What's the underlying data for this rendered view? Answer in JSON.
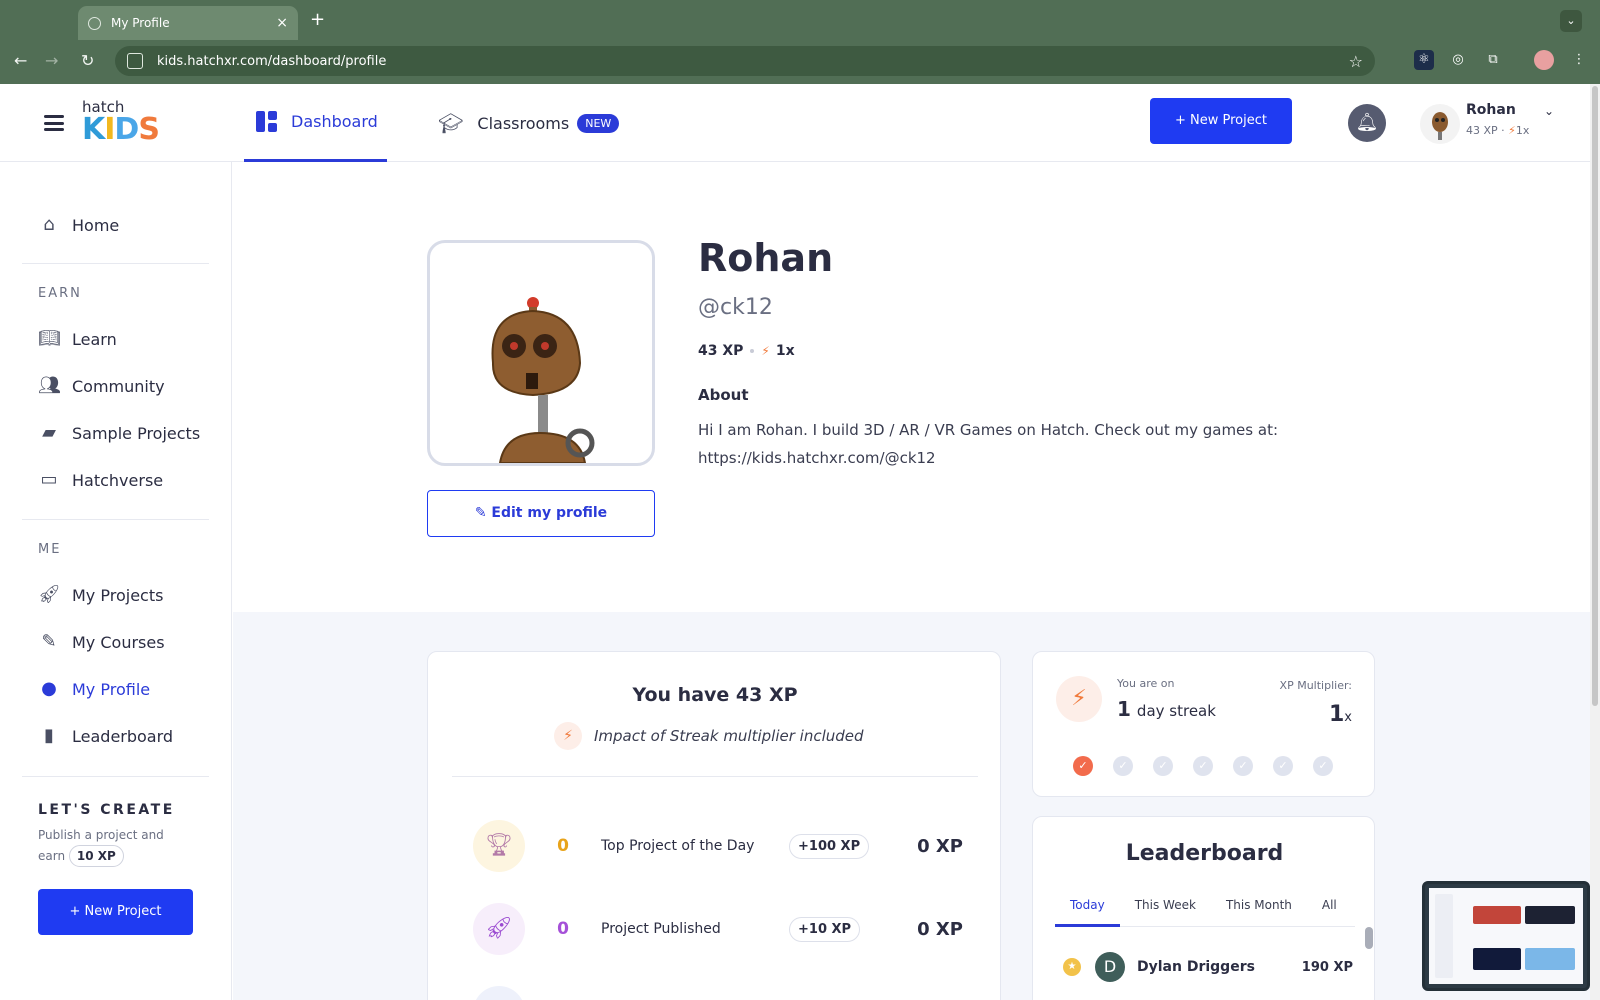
{
  "browser": {
    "tab_title": "My Profile",
    "close": "×",
    "new_tab": "+",
    "url": "kids.hatchxr.com/dashboard/profile"
  },
  "header": {
    "logo_top": "hatch",
    "logo_bottom": "KIDS",
    "nav_dashboard": "Dashboard",
    "nav_classrooms": "Classrooms",
    "badge_new": "NEW",
    "new_project": "+ New Project",
    "user_name": "Rohan",
    "user_xp": "43 XP",
    "user_mult": "1x"
  },
  "sidebar": {
    "home": "Home",
    "earn_heading": "EARN",
    "learn": "Learn",
    "community": "Community",
    "sample_projects": "Sample Projects",
    "hatchverse": "Hatchverse",
    "me_heading": "ME",
    "my_projects": "My Projects",
    "my_courses": "My Courses",
    "my_profile": "My Profile",
    "leaderboard": "Leaderboard",
    "lets_create": "LET'S CREATE",
    "lc_text": "Publish a project and earn",
    "lc_xp": "10 XP",
    "new_project": "+ New Project"
  },
  "profile": {
    "name": "Rohan",
    "handle": "@ck12",
    "xp": "43 XP",
    "mult": "1x",
    "about_heading": "About",
    "about_text": "Hi I am Rohan. I build 3D / AR / VR Games on Hatch. Check out my games at: https://kids.hatchxr.com/@ck12",
    "edit_button": "Edit my profile"
  },
  "xp_card": {
    "title": "You have 43 XP",
    "subtitle": "Impact of Streak multiplier included",
    "rows": [
      {
        "count": "0",
        "label": "Top Project of the Day",
        "award": "+100 XP",
        "earned": "0 XP"
      },
      {
        "count": "0",
        "label": "Project Published",
        "award": "+10 XP",
        "earned": "0 XP"
      }
    ]
  },
  "streak": {
    "you_are_on": "You are on",
    "days_num": "1",
    "days_label": "day streak",
    "mult_label": "XP Multiplier:",
    "mult_num": "1",
    "mult_x": "x",
    "days_completed": 1,
    "days_total": 7
  },
  "leaderboard": {
    "title": "Leaderboard",
    "tabs": [
      "Today",
      "This Week",
      "This Month",
      "All"
    ],
    "active_tab": "Today",
    "rows": [
      {
        "initial": "D",
        "name": "Dylan Driggers",
        "xp": "190 XP"
      }
    ]
  },
  "colors": {
    "accent": "#1f3bf2",
    "streak": "#f26b4c",
    "chrome": "#516e55"
  }
}
